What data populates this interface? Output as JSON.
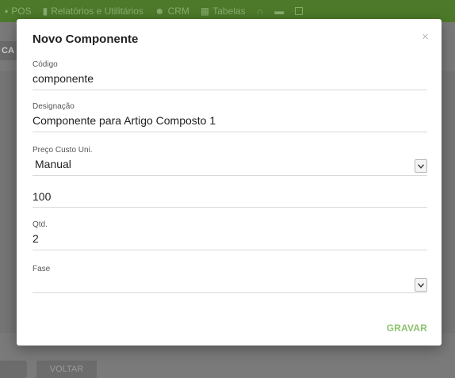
{
  "background": {
    "topbar_items": [
      {
        "icon": "pos-icon",
        "label": "POS"
      },
      {
        "icon": "chart-icon",
        "label": "Relatórios e Utilitários"
      },
      {
        "icon": "people-icon",
        "label": "CRM"
      },
      {
        "icon": "grid-icon",
        "label": "Tabelas"
      },
      {
        "icon": "headset-icon",
        "label": ""
      },
      {
        "icon": "document-icon",
        "label": ""
      },
      {
        "icon": "window-icon",
        "label": ""
      }
    ],
    "tab_label": "CA",
    "bottom_button": "VOLTAR"
  },
  "modal": {
    "title": "Novo Componente",
    "close_symbol": "×",
    "fields": {
      "codigo": {
        "label": "Código",
        "value": "componente"
      },
      "designacao": {
        "label": "Designação",
        "value": "Componente para Artigo Composto 1"
      },
      "preco": {
        "label": "Preço Custo Uni.",
        "selected": "Manual"
      },
      "preco_valor": {
        "value": "100"
      },
      "qtd": {
        "label": "Qtd.",
        "value": "2"
      },
      "fase": {
        "label": "Fase",
        "selected": ""
      }
    },
    "save_label": "GRAVAR"
  },
  "colors": {
    "accent": "#8dc26f",
    "topbar": "#4d7a2a"
  }
}
